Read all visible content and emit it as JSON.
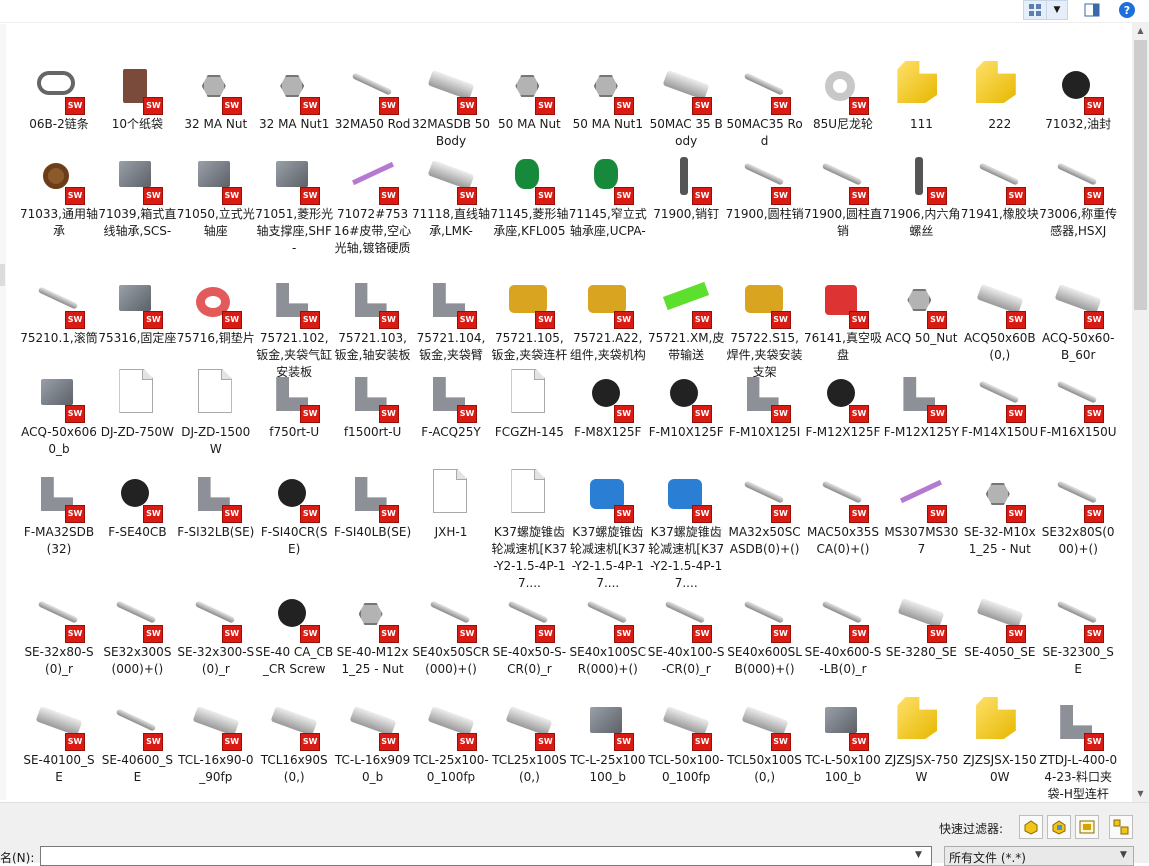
{
  "toolbar": {
    "view_icon": "large-icons-view-icon",
    "view_dropdown": "chevron-down-icon",
    "preview_pane_icon": "preview-pane-icon",
    "help": "?"
  },
  "files": [
    {
      "name": "06B-2链条",
      "icon": "chain",
      "sw": true
    },
    {
      "name": "10个纸袋",
      "icon": "box",
      "sw": true
    },
    {
      "name": "32 MA Nut",
      "icon": "nut",
      "sw": true
    },
    {
      "name": "32 MA Nut1",
      "icon": "nut",
      "sw": true
    },
    {
      "name": "32MA50 Rod",
      "icon": "rod",
      "sw": true
    },
    {
      "name": "32MASDB 50 Body",
      "icon": "cyl",
      "sw": true
    },
    {
      "name": "50 MA Nut",
      "icon": "nut",
      "sw": true
    },
    {
      "name": "50 MA Nut1",
      "icon": "nut",
      "sw": true
    },
    {
      "name": "50MAC 35 Body",
      "icon": "cyl",
      "sw": true
    },
    {
      "name": "50MAC35 Rod",
      "icon": "rod",
      "sw": true
    },
    {
      "name": "85U尼龙轮",
      "icon": "ring",
      "sw": true
    },
    {
      "name": "111",
      "icon": "yellow",
      "sw": false
    },
    {
      "name": "222",
      "icon": "yellow",
      "sw": false
    },
    {
      "name": "71032,油封",
      "icon": "dark",
      "sw": true
    },
    {
      "name": "71033,通用轴承",
      "icon": "brown",
      "sw": true
    },
    {
      "name": "71039,箱式直线轴承,SCS-",
      "icon": "block",
      "sw": true
    },
    {
      "name": "71050,立式光轴座",
      "icon": "block",
      "sw": true
    },
    {
      "name": "71051,菱形光轴支撑座,SHF-",
      "icon": "block",
      "sw": true
    },
    {
      "name": "71072#75316#皮带,空心光轴,镀铬硬质",
      "icon": "purple",
      "sw": true
    },
    {
      "name": "71118,直线轴承,LMK-",
      "icon": "cyl",
      "sw": true
    },
    {
      "name": "71145,菱形轴承座,KFL005",
      "icon": "green",
      "sw": true
    },
    {
      "name": "71145,窄立式轴承座,UCPA-",
      "icon": "green",
      "sw": true
    },
    {
      "name": "71900,销钉",
      "icon": "pin",
      "sw": true
    },
    {
      "name": "71900,圆柱销",
      "icon": "rod",
      "sw": true
    },
    {
      "name": "71900,圆柱直销",
      "icon": "rod",
      "sw": true
    },
    {
      "name": "71906,内六角螺丝",
      "icon": "pin",
      "sw": true
    },
    {
      "name": "71941,橡胶块",
      "icon": "rod",
      "sw": true
    },
    {
      "name": "73006,称重传感器,HSXJ",
      "icon": "rod",
      "sw": true
    },
    {
      "name": "75210.1,滚筒",
      "icon": "rod",
      "sw": true
    },
    {
      "name": "75316,固定座",
      "icon": "block",
      "sw": true
    },
    {
      "name": "75716,铜垫片",
      "icon": "pink",
      "sw": true
    },
    {
      "name": "75721.102,钣金,夹袋气缸安装板",
      "icon": "bracket",
      "sw": true
    },
    {
      "name": "75721.103,钣金,轴安装板",
      "icon": "bracket",
      "sw": true
    },
    {
      "name": "75721.104,钣金,夹袋臂",
      "icon": "bracket",
      "sw": true
    },
    {
      "name": "75721.105,钣金,夹袋连杆",
      "icon": "gold",
      "sw": true
    },
    {
      "name": "75721.A22,组件,夹袋机构",
      "icon": "gold",
      "sw": true
    },
    {
      "name": "75721.XM,皮带输送",
      "icon": "lime",
      "sw": true
    },
    {
      "name": "75722.S15,焊件,夹袋安装支架",
      "icon": "gold",
      "sw": true
    },
    {
      "name": "76141,真空吸盘",
      "icon": "red",
      "sw": true
    },
    {
      "name": "ACQ 50_Nut",
      "icon": "nut",
      "sw": true
    },
    {
      "name": "ACQ50x60B(0,)",
      "icon": "cyl",
      "sw": true
    },
    {
      "name": "ACQ-50x60-B_60r",
      "icon": "cyl",
      "sw": true
    },
    {
      "name": "ACQ-50x6060_b",
      "icon": "block",
      "sw": true
    },
    {
      "name": "DJ-ZD-750W",
      "icon": "doc",
      "sw": false
    },
    {
      "name": "DJ-ZD-1500W",
      "icon": "doc",
      "sw": false
    },
    {
      "name": "f750rt-U",
      "icon": "bracket",
      "sw": true
    },
    {
      "name": "f1500rt-U",
      "icon": "bracket",
      "sw": true
    },
    {
      "name": "F-ACQ25Y",
      "icon": "bracket",
      "sw": true
    },
    {
      "name": "FCGZH-145",
      "icon": "doc",
      "sw": false
    },
    {
      "name": "F-M8X125F",
      "icon": "dark",
      "sw": true
    },
    {
      "name": "F-M10X125F",
      "icon": "dark",
      "sw": true
    },
    {
      "name": "F-M10X125I",
      "icon": "bracket",
      "sw": true
    },
    {
      "name": "F-M12X125F",
      "icon": "dark",
      "sw": true
    },
    {
      "name": "F-M12X125Y",
      "icon": "bracket",
      "sw": true
    },
    {
      "name": "F-M14X150U",
      "icon": "rod",
      "sw": true
    },
    {
      "name": "F-M16X150U",
      "icon": "rod",
      "sw": true
    },
    {
      "name": "F-MA32SDB (32)",
      "icon": "bracket",
      "sw": true
    },
    {
      "name": "F-SE40CB",
      "icon": "dark",
      "sw": true
    },
    {
      "name": "F-SI32LB(SE)",
      "icon": "bracket",
      "sw": true
    },
    {
      "name": "F-SI40CR(SE)",
      "icon": "dark",
      "sw": true
    },
    {
      "name": "F-SI40LB(SE)",
      "icon": "bracket",
      "sw": true
    },
    {
      "name": "JXH-1",
      "icon": "doc",
      "sw": false
    },
    {
      "name": "K37螺旋锥齿轮减速机[K37-Y2-1.5-4P-17....",
      "icon": "doc",
      "sw": false
    },
    {
      "name": "K37螺旋锥齿轮减速机[K37-Y2-1.5-4P-17....",
      "icon": "blue",
      "sw": true
    },
    {
      "name": "K37螺旋锥齿轮减速机[K37-Y2-1.5-4P-17....",
      "icon": "blue",
      "sw": true
    },
    {
      "name": "MA32x50SCASDB(0)+()",
      "icon": "rod",
      "sw": true
    },
    {
      "name": "MAC50x35SCA(0)+()",
      "icon": "rod",
      "sw": true
    },
    {
      "name": "MS307MS307",
      "icon": "purple",
      "sw": true
    },
    {
      "name": "SE-32-M10x1_25 - Nut",
      "icon": "nut",
      "sw": true
    },
    {
      "name": "SE32x80S(000)+()",
      "icon": "rod",
      "sw": true
    },
    {
      "name": "SE-32x80-S(0)_r",
      "icon": "rod",
      "sw": true
    },
    {
      "name": "SE32x300S(000)+()",
      "icon": "rod",
      "sw": true
    },
    {
      "name": "SE-32x300-S(0)_r",
      "icon": "rod",
      "sw": true
    },
    {
      "name": "SE-40 CA_CB_CR Screw",
      "icon": "dark",
      "sw": true
    },
    {
      "name": "SE-40-M12x1_25 - Nut",
      "icon": "nut",
      "sw": true
    },
    {
      "name": "SE40x50SCR(000)+()",
      "icon": "rod",
      "sw": true
    },
    {
      "name": "SE-40x50-S-CR(0)_r",
      "icon": "rod",
      "sw": true
    },
    {
      "name": "SE40x100SCR(000)+()",
      "icon": "rod",
      "sw": true
    },
    {
      "name": "SE-40x100-S-CR(0)_r",
      "icon": "rod",
      "sw": true
    },
    {
      "name": "SE40x600SLB(000)+()",
      "icon": "rod",
      "sw": true
    },
    {
      "name": "SE-40x600-S-LB(0)_r",
      "icon": "rod",
      "sw": true
    },
    {
      "name": "SE-3280_SE",
      "icon": "cyl",
      "sw": true
    },
    {
      "name": "SE-4050_SE",
      "icon": "cyl",
      "sw": true
    },
    {
      "name": "SE-32300_SE",
      "icon": "rod",
      "sw": true
    },
    {
      "name": "SE-40100_SE",
      "icon": "cyl",
      "sw": true
    },
    {
      "name": "SE-40600_SE",
      "icon": "rod",
      "sw": true
    },
    {
      "name": "TCL-16x90-0_90fp",
      "icon": "cyl",
      "sw": true
    },
    {
      "name": "TCL16x90S(0,)",
      "icon": "cyl",
      "sw": true
    },
    {
      "name": "TC-L-16x9090_b",
      "icon": "cyl",
      "sw": true
    },
    {
      "name": "TCL-25x100-0_100fp",
      "icon": "cyl",
      "sw": true
    },
    {
      "name": "TCL25x100S(0,)",
      "icon": "cyl",
      "sw": true
    },
    {
      "name": "TC-L-25x100100_b",
      "icon": "block",
      "sw": true
    },
    {
      "name": "TCL-50x100-0_100fp",
      "icon": "cyl",
      "sw": true
    },
    {
      "name": "TCL50x100S(0,)",
      "icon": "cyl",
      "sw": true
    },
    {
      "name": "TC-L-50x100100_b",
      "icon": "block",
      "sw": true
    },
    {
      "name": "ZJZSJSX-750W",
      "icon": "yellow",
      "sw": false
    },
    {
      "name": "ZJZSJSX-1500W",
      "icon": "yellow",
      "sw": false
    },
    {
      "name": "ZTDJ-L-400-04-23-料口夹袋-H型连杆",
      "icon": "bracket",
      "sw": true
    }
  ],
  "filter": {
    "label": "快速过滤器:",
    "buttons": [
      "filter-parts-icon",
      "filter-assemblies-icon",
      "filter-drawings-icon",
      "filter-top-level-assemblies-icon"
    ]
  },
  "filename": {
    "label": "名(N):",
    "value": ""
  },
  "filetype": {
    "value": "所有文件 (*.*)"
  }
}
